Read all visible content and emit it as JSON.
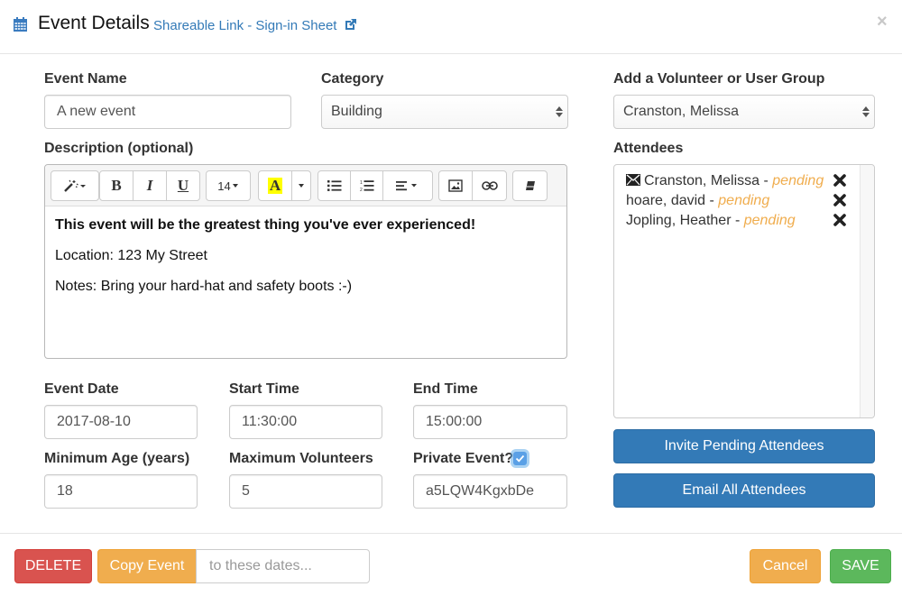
{
  "header": {
    "title": "Event Details",
    "share_link": "Shareable Link - Sign-in Sheet",
    "close_label": "×",
    "icons": {
      "title": "calendar-icon",
      "link": "external-link-icon",
      "close": "close-icon"
    }
  },
  "form": {
    "event_name": {
      "label": "Event Name",
      "value": "A new event"
    },
    "category": {
      "label": "Category",
      "value": "Building"
    },
    "description": {
      "label": "Description (optional)",
      "toolbar": {
        "font_size": "14",
        "buttons": [
          "magic-style",
          "bold",
          "italic",
          "underline",
          "font-size",
          "highlight-color",
          "color-dropdown",
          "unordered-list",
          "ordered-list",
          "paragraph-align",
          "insert-picture",
          "insert-link",
          "clear-formatting"
        ]
      },
      "paragraphs": [
        {
          "text": "This event will be the greatest thing you've ever experienced!",
          "bold": true
        },
        {
          "text": "Location: 123 My Street",
          "bold": false
        },
        {
          "text": "Notes: Bring your hard-hat and safety boots :-)",
          "bold": false
        }
      ]
    },
    "event_date": {
      "label": "Event Date",
      "value": "2017-08-10"
    },
    "start_time": {
      "label": "Start Time",
      "value": "11:30:00"
    },
    "end_time": {
      "label": "End Time",
      "value": "15:00:00"
    },
    "minimum_age": {
      "label": "Minimum Age (years)",
      "value": "18"
    },
    "maximum_volunteers": {
      "label": "Maximum Volunteers",
      "value": "5"
    },
    "private_event": {
      "label": "Private Event?",
      "checked": true,
      "value": "a5LQW4KgxbDe"
    }
  },
  "volunteers": {
    "add_label": "Add a Volunteer or User Group",
    "add_value": "Cranston, Melissa",
    "attendees_label": "Attendees",
    "attendees": [
      {
        "name": "Cranston, Melissa",
        "separator": " - ",
        "status": "pending",
        "emailed": true
      },
      {
        "name": "hoare, david",
        "separator": " - ",
        "status": "pending",
        "emailed": false
      },
      {
        "name": "Jopling, Heather",
        "separator": " - ",
        "status": "pending",
        "emailed": false
      }
    ],
    "invite_button": "Invite Pending Attendees",
    "email_button": "Email All Attendees"
  },
  "footer": {
    "delete_button": "DELETE",
    "copy_button": "Copy Event",
    "copy_placeholder": "to these dates...",
    "cancel_button": "Cancel",
    "save_button": "SAVE"
  },
  "colors": {
    "primary": "#337ab7",
    "danger": "#d9534f",
    "warning": "#f0ad4e",
    "success": "#5cb85c",
    "pending_text": "#f0ad4e"
  }
}
